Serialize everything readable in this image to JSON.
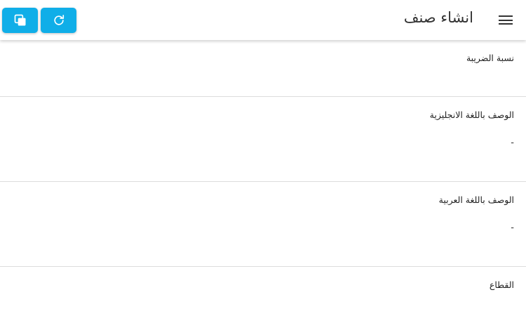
{
  "header": {
    "title": "انشاء صنف",
    "menu_icon": "hamburger-menu-icon",
    "copy_icon": "copy-icon",
    "refresh_icon": "refresh-icon",
    "button_color": "#10aee8"
  },
  "fields": [
    {
      "label": "نسبة الضريبة",
      "value": ""
    },
    {
      "label": "الوصف باللغة الانجليزية",
      "value": "-"
    },
    {
      "label": "الوصف باللغة العربية",
      "value": "-"
    },
    {
      "label": "القطاع",
      "value": ""
    }
  ]
}
